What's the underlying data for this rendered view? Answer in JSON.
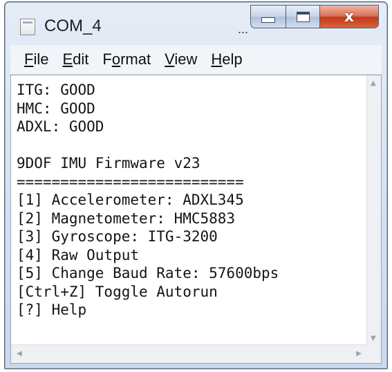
{
  "window": {
    "title": "COM_4",
    "title_ellipsis": "...",
    "close_glyph": "x"
  },
  "menu": {
    "items": [
      {
        "mnemonic": "F",
        "rest": "ile"
      },
      {
        "mnemonic": "E",
        "rest": "dit"
      },
      {
        "pre": "F",
        "mnemonic": "o",
        "rest": "rmat"
      },
      {
        "mnemonic": "V",
        "rest": "iew"
      },
      {
        "mnemonic": "H",
        "rest": "elp"
      }
    ]
  },
  "terminal": {
    "lines": [
      "ITG: GOOD",
      "HMC: GOOD",
      "ADXL: GOOD",
      "",
      "9DOF IMU Firmware v23",
      "==========================",
      "[1] Accelerometer: ADXL345",
      "[2] Magnetometer: HMC5883",
      "[3] Gyroscope: ITG-3200",
      "[4] Raw Output",
      "[5] Change Baud Rate: 57600bps",
      "[Ctrl+Z] Toggle Autorun",
      "[?] Help"
    ]
  },
  "icons": {
    "app": "notepad-icon",
    "minimize": "minimize-icon",
    "maximize": "maximize-icon",
    "close": "close-icon"
  },
  "colors": {
    "close_button": "#c4391b",
    "frame": "#c9d8ec",
    "text": "#141414"
  }
}
